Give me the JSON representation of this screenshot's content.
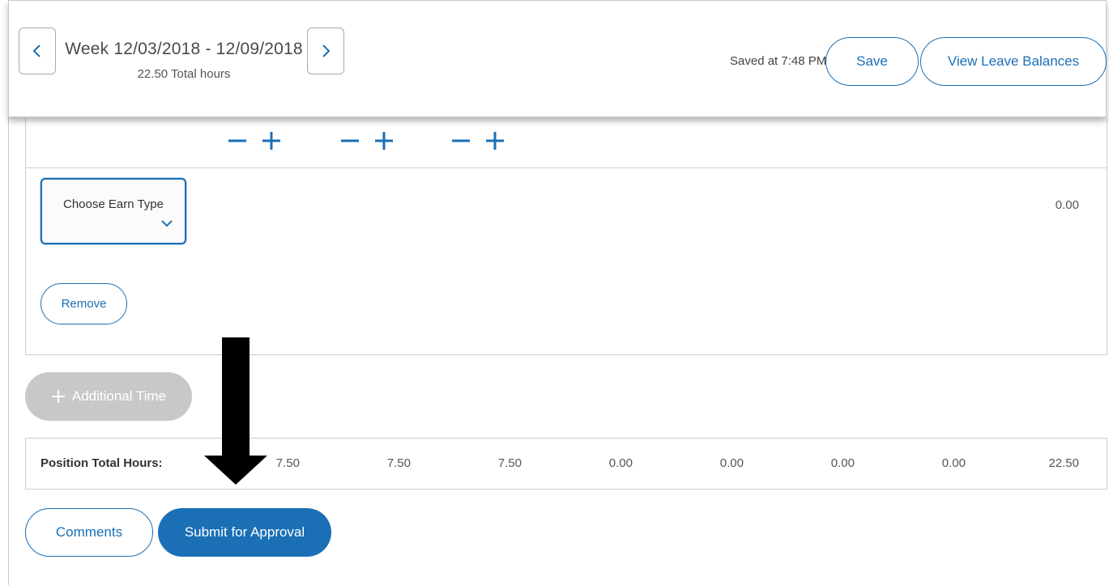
{
  "header": {
    "week_title": "Week 12/03/2018 - 12/09/2018",
    "total_hours": "22.50 Total hours",
    "saved_status": "Saved at 7:48 PM",
    "save_label": "Save",
    "leave_balances_label": "View Leave Balances",
    "prev_icon": "chevron-left-icon",
    "next_icon": "chevron-right-icon"
  },
  "entry": {
    "steppers": [
      {
        "minus": "−",
        "plus": "+"
      },
      {
        "minus": "−",
        "plus": "+"
      },
      {
        "minus": "−",
        "plus": "+"
      }
    ],
    "earn_type": {
      "label": "Choose Earn Type",
      "icon": "chevron-down-icon"
    },
    "row_total": "0.00",
    "remove_label": "Remove"
  },
  "additional_time_label": "Additional Time",
  "totals": {
    "label": "Position Total Hours:",
    "values": [
      "7.50",
      "7.50",
      "7.50",
      "0.00",
      "0.00",
      "0.00",
      "0.00",
      "22.50"
    ]
  },
  "actions": {
    "comments_label": "Comments",
    "submit_label": "Submit for Approval"
  },
  "colors": {
    "accent": "#1a6fb5",
    "disabled": "#c8c8c8",
    "border": "#cdcdcd"
  }
}
